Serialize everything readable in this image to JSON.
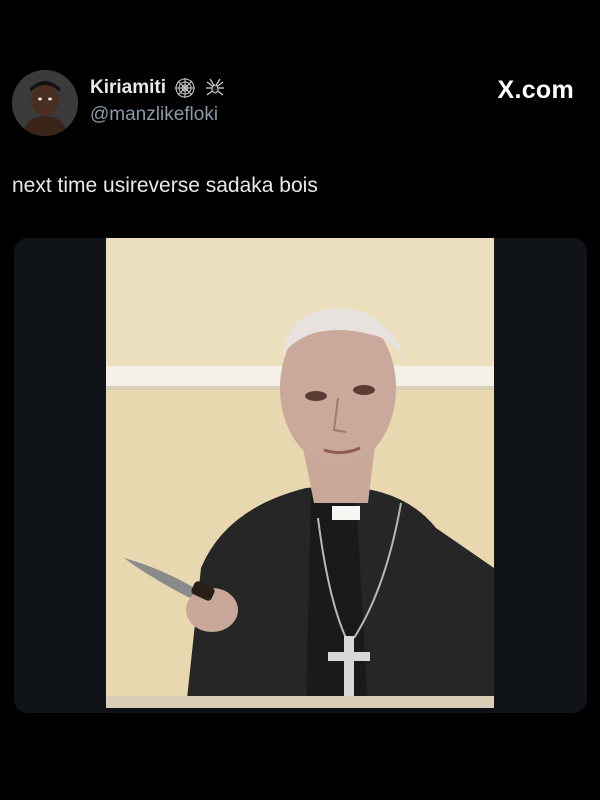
{
  "tweet": {
    "author": {
      "display_name": "Kiriamiti",
      "handle": "@manzlikefloki",
      "name_emojis": [
        "spiderweb-icon",
        "spider-icon"
      ]
    },
    "brand": "X.com",
    "text": "next time usireverse sadaka bois",
    "media": {
      "type": "video-still"
    }
  },
  "colors": {
    "background": "#000000",
    "text_primary": "#e7e9ea",
    "text_secondary": "#8b98a5",
    "media_bg": "#0d1014"
  }
}
